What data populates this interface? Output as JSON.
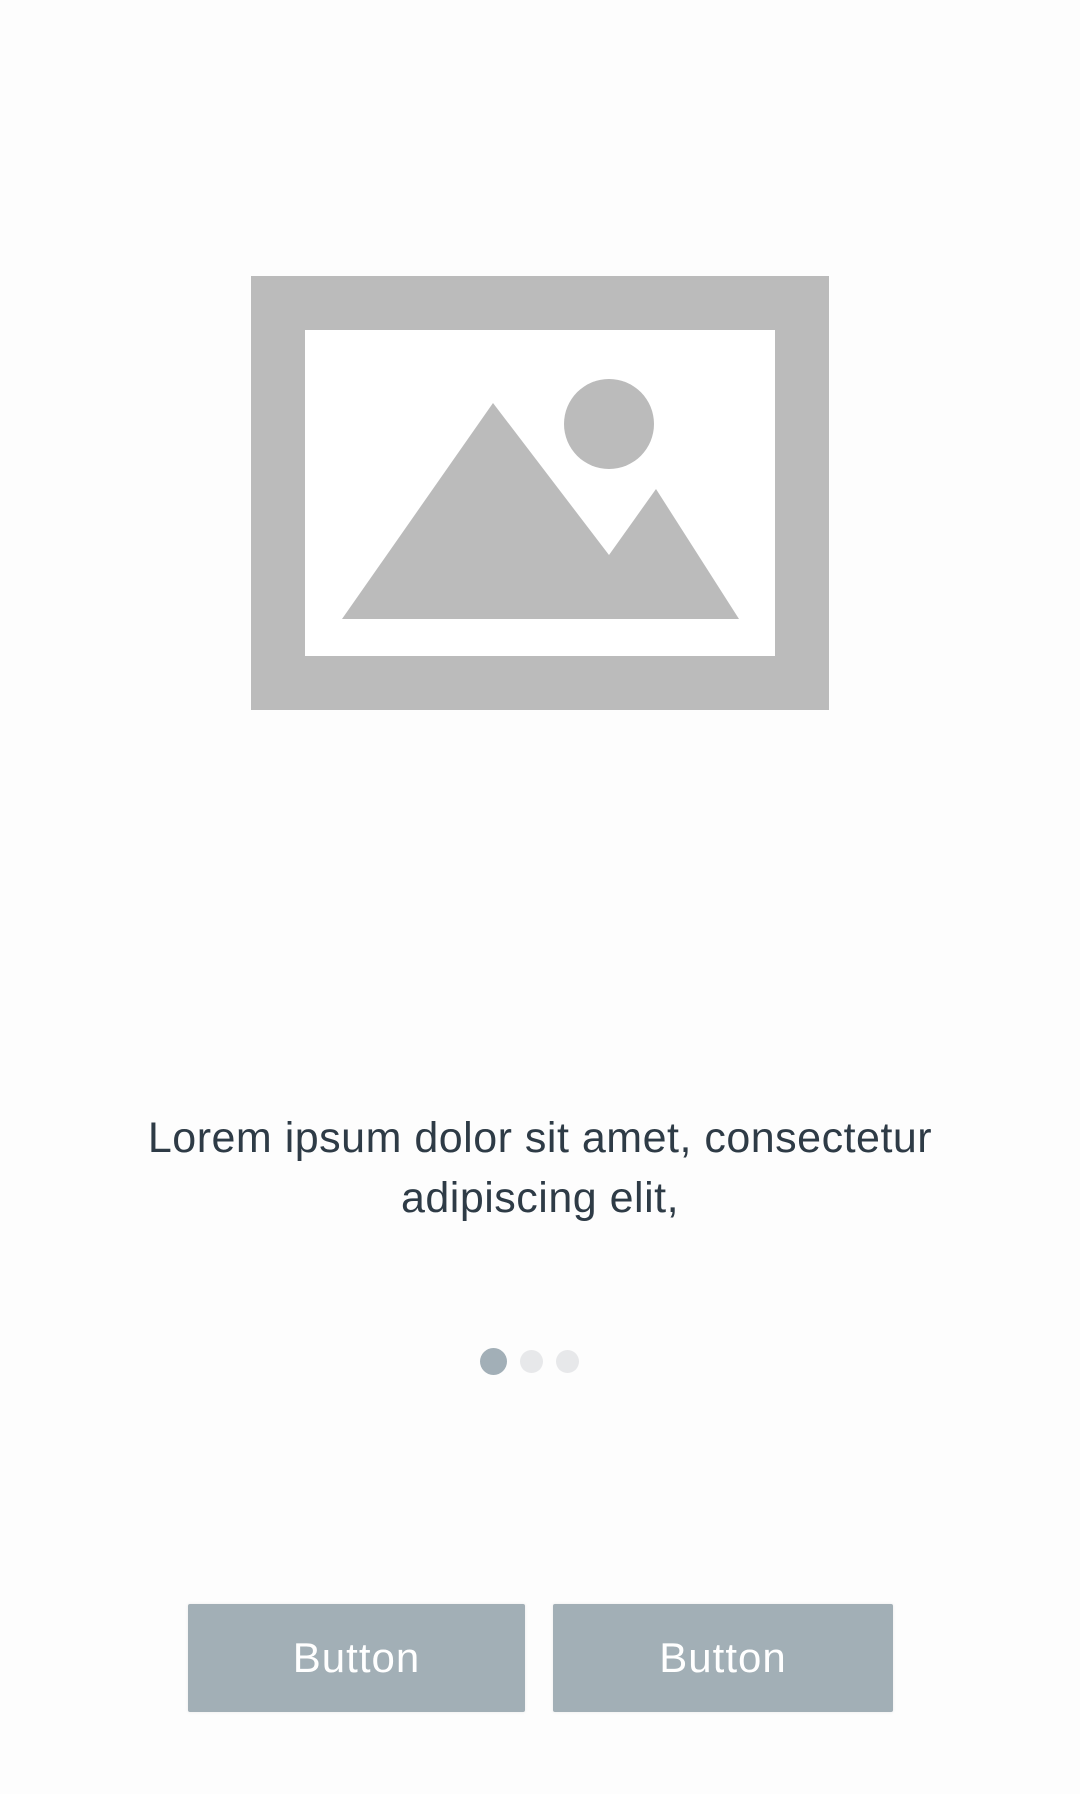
{
  "hero": {
    "icon": "image-placeholder-icon"
  },
  "body_text": {
    "line1": "Lorem ipsum dolor sit amet, consectetur",
    "line2": "adipiscing elit,"
  },
  "pager": {
    "total": 3,
    "current": 1
  },
  "actions": {
    "left_label": "Button",
    "right_label": "Button"
  },
  "colors": {
    "placeholder_gray": "#bbbbbb",
    "text": "#2e3b46",
    "dot_active": "#a2afb7",
    "dot_inactive": "#e7e8ea",
    "button_bg": "#a2afb6",
    "button_text": "#ffffff"
  }
}
